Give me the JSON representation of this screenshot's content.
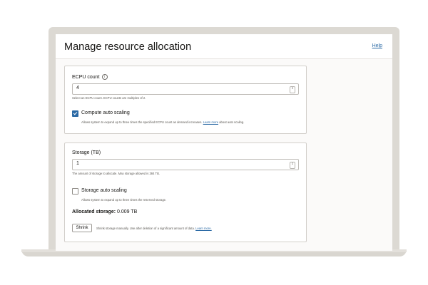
{
  "page": {
    "title": "Manage resource allocation",
    "help_label": "Help"
  },
  "ecpu": {
    "label": "ECPU count",
    "info_icon": "info-icon",
    "value": "4",
    "hint": "Select an ECPU count. ECPU counts are multiples of 2."
  },
  "compute_auto_scaling": {
    "label": "Compute auto scaling",
    "checked": true,
    "hint_prefix": "Allows system to expand up to three times the specified ECPU count as demand increases.",
    "link": "Learn more",
    "hint_suffix": "about auto scaling."
  },
  "storage": {
    "label": "Storage (TB)",
    "value": "1",
    "hint": "The amount of storage to allocate. Max storage allowed is 384 TB."
  },
  "storage_auto_scaling": {
    "label": "Storage auto scaling",
    "checked": false,
    "hint": "Allows system to expand up to three times the reserved storage."
  },
  "allocated": {
    "label": "Allocated storage:",
    "value": "0.009 TB"
  },
  "shrink": {
    "button_label": "Shrink",
    "hint": "Shrink storage manually. Use after deletion of a significant amount of data.",
    "link": "Learn more."
  },
  "colors": {
    "accent": "#2b6aa5",
    "frame": "#dcd9d3",
    "panel_border": "#d2cfca"
  }
}
